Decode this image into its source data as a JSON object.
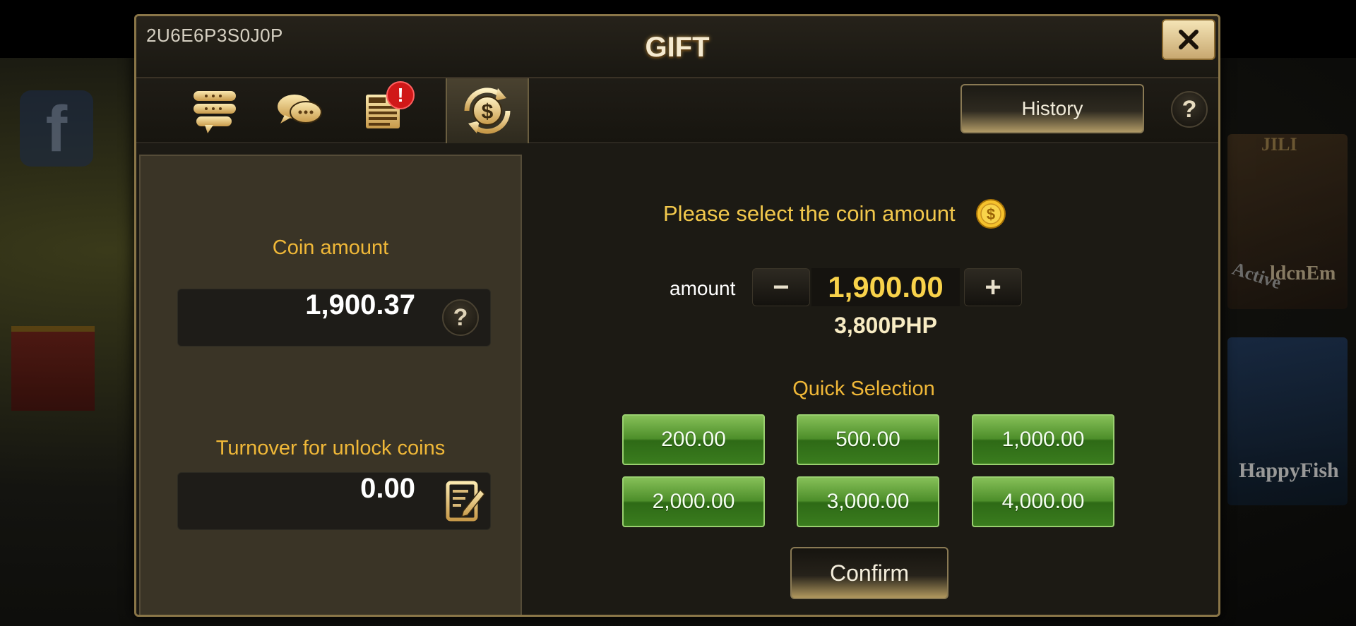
{
  "dialog": {
    "user_id": "2U6E6P3S0J0P",
    "title": "GIFT",
    "close_symbol": "✕"
  },
  "tabs": [
    {
      "icon": "vip-chat-icon",
      "active": false
    },
    {
      "icon": "message-bubbles-icon",
      "active": false
    },
    {
      "icon": "news-icon",
      "active": false,
      "badge": "!"
    },
    {
      "icon": "coin-exchange-icon",
      "active": true
    }
  ],
  "toolbar": {
    "history_label": "History",
    "help_symbol": "?"
  },
  "left_panel": {
    "coin_amount_label": "Coin amount",
    "coin_amount_value": "1,900.37",
    "help_symbol": "?",
    "turnover_label": "Turnover for unlock coins",
    "turnover_value": "0.00"
  },
  "gift_form": {
    "prompt": "Please select the coin amount",
    "amount_label": "amount",
    "minus_symbol": "−",
    "plus_symbol": "+",
    "amount_value": "1,900.00",
    "php_value": "3,800PHP",
    "quick_selection_label": "Quick Selection",
    "quick_options": [
      "200.00",
      "500.00",
      "1,000.00",
      "2,000.00",
      "3,000.00",
      "4,000.00"
    ],
    "confirm_label": "Confirm"
  },
  "background": {
    "game1_tag": "JILI",
    "game1_name": "ldcnEm",
    "game1_badge": "Active",
    "game2_name": "HappyFish"
  },
  "colors": {
    "gold_text": "#f0b838",
    "amount_gold": "#f8d24a",
    "quick_green": "#4d8e2a",
    "badge_red": "#d01818",
    "frame": "#8a7648"
  }
}
